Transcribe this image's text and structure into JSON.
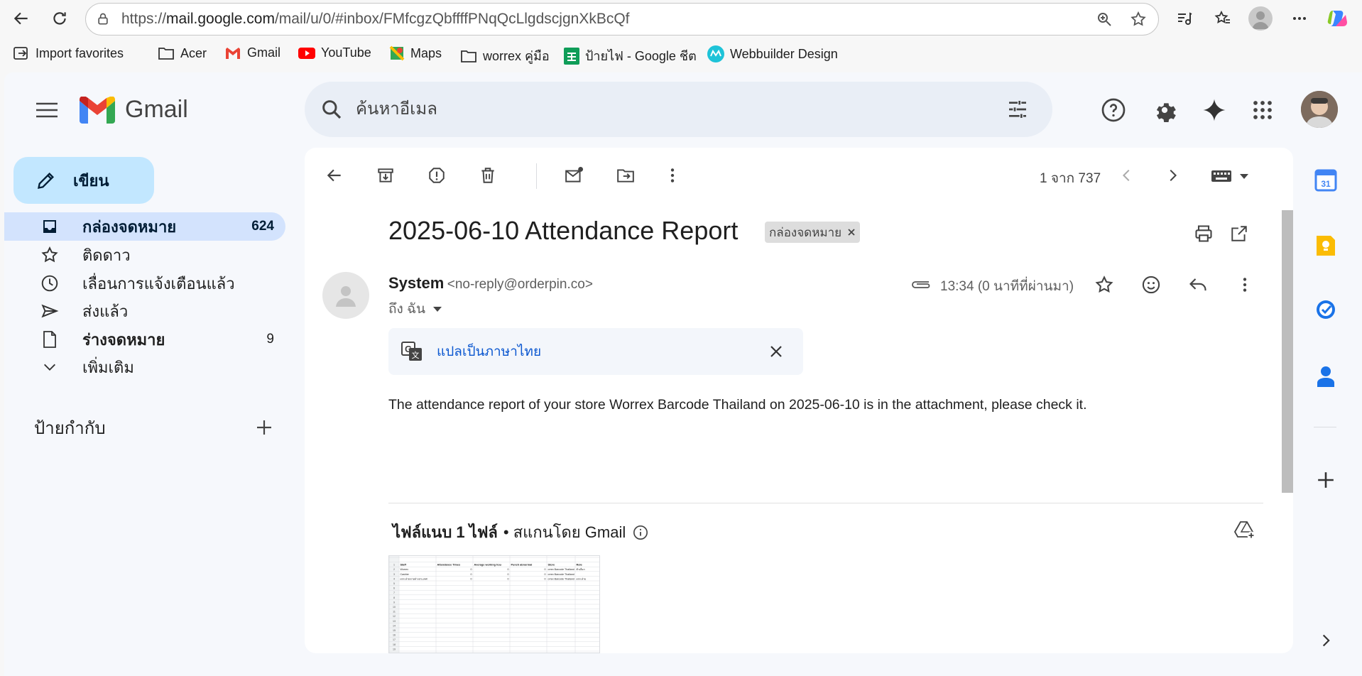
{
  "browser": {
    "url_prefix": "https://",
    "url_host": "mail.google.com",
    "url_path": "/mail/u/0/#inbox/FMfcgzQbffffPNqQcLlgdscjgnXkBcQf",
    "bookmarks": [
      {
        "label": "Import favorites",
        "icon": "import-icon"
      },
      {
        "label": "Acer",
        "icon": "folder-icon"
      },
      {
        "label": "Gmail",
        "icon": "gmail-icon"
      },
      {
        "label": "YouTube",
        "icon": "youtube-icon"
      },
      {
        "label": "Maps",
        "icon": "maps-icon"
      },
      {
        "label": "worrex คู่มือ",
        "icon": "folder-icon"
      },
      {
        "label": "ป้ายไฟ - Google ชีต",
        "icon": "sheets-icon"
      },
      {
        "label": "Webbuilder Design",
        "icon": "webbuilder-icon"
      }
    ]
  },
  "header": {
    "app_name": "Gmail",
    "search_placeholder": "ค้นหาอีเมล"
  },
  "sidebar": {
    "compose_label": "เขียน",
    "items": [
      {
        "label": "กล่องจดหมาย",
        "count": "624",
        "icon": "inbox-icon",
        "active": true
      },
      {
        "label": "ติดดาว",
        "count": "",
        "icon": "star-icon",
        "active": false
      },
      {
        "label": "เลื่อนการแจ้งเตือนแล้ว",
        "count": "",
        "icon": "clock-icon",
        "active": false
      },
      {
        "label": "ส่งแล้ว",
        "count": "",
        "icon": "send-icon",
        "active": false
      },
      {
        "label": "ร่างจดหมาย",
        "count": "9",
        "icon": "draft-icon",
        "active": false
      },
      {
        "label": "เพิ่มเติม",
        "count": "",
        "icon": "chevron-down-icon",
        "active": false
      }
    ],
    "labels_title": "ป้ายกำกับ"
  },
  "toolbar": {
    "pager": "1 จาก 737"
  },
  "message": {
    "subject": "2025-06-10 Attendance Report",
    "label_chip": "กล่องจดหมาย",
    "sender_name": "System",
    "sender_email": "<no-reply@orderpin.co>",
    "to": "ถึง ฉัน",
    "time": "13:34 (0 นาทีที่ผ่านมา)",
    "translate_label": "แปลเป็นภาษาไทย",
    "body": "The attendance report of your store Worrex Barcode Thailand on 2025-06-10 is in the attachment, please check it.",
    "attachments_title": "ไฟล์แนบ 1 ไฟล์",
    "attachments_scan": " • สแกนโดย Gmail"
  },
  "attachment_preview": {
    "headers": [
      "Staff",
      "Attendance Times",
      "Average working hou",
      "Punch abnormal",
      "Store",
      "Role"
    ],
    "rows": [
      [
        "Worrex",
        "0",
        "0",
        "0",
        "orrex Barcode Thailand",
        "ตัวเลือก"
      ],
      [
        "Cashier",
        "0",
        "0",
        "0",
        "orrex Barcode Thailand",
        ""
      ],
      [
        "ผจก.ฝ่ายขายต่างประเทศ",
        "0",
        "0",
        "0",
        "orrex Barcode Thailand",
        "ผจก.ฝ่าย"
      ]
    ]
  },
  "colors": {
    "compose_bg": "#c2e7ff",
    "active_item_bg": "#d3e3fd",
    "search_bg": "#e9eef6",
    "link": "#0b57d0"
  }
}
